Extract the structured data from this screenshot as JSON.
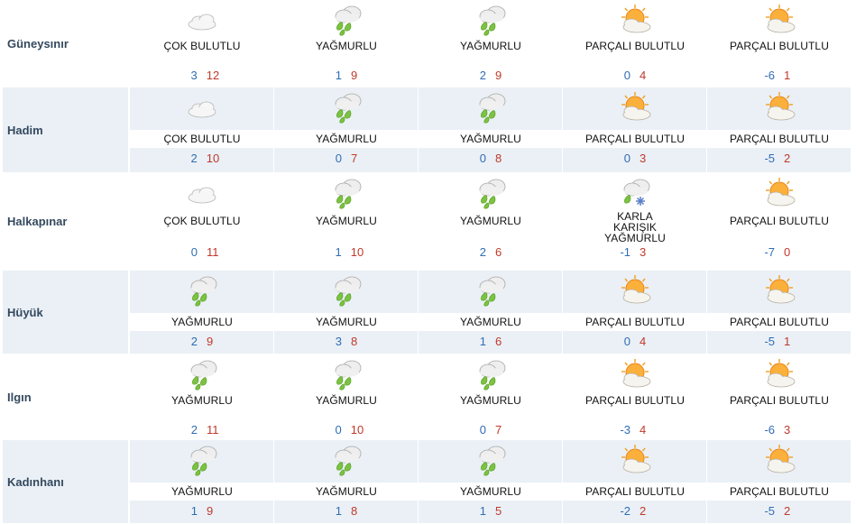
{
  "colors": {
    "city_text": "#34495e",
    "min_temp": "#2f6db5",
    "max_temp": "#c0392b",
    "row_shade": "#eaf0f6"
  },
  "rows": [
    {
      "city": "Güneysınır",
      "days": [
        {
          "icon": "cloudy-icon",
          "condition": "ÇOK BULUTLU",
          "min": "3",
          "max": "12"
        },
        {
          "icon": "rain-icon",
          "condition": "YAĞMURLU",
          "min": "1",
          "max": "9"
        },
        {
          "icon": "rain-icon",
          "condition": "YAĞMURLU",
          "min": "2",
          "max": "9"
        },
        {
          "icon": "partly-cloudy-icon",
          "condition": "PARÇALI BULUTLU",
          "min": "0",
          "max": "4"
        },
        {
          "icon": "partly-cloudy-icon",
          "condition": "PARÇALI BULUTLU",
          "min": "-6",
          "max": "1"
        }
      ]
    },
    {
      "city": "Hadim",
      "days": [
        {
          "icon": "cloudy-icon",
          "condition": "ÇOK BULUTLU",
          "min": "2",
          "max": "10"
        },
        {
          "icon": "rain-icon",
          "condition": "YAĞMURLU",
          "min": "0",
          "max": "7"
        },
        {
          "icon": "rain-icon",
          "condition": "YAĞMURLU",
          "min": "0",
          "max": "8"
        },
        {
          "icon": "partly-cloudy-icon",
          "condition": "PARÇALI BULUTLU",
          "min": "0",
          "max": "3"
        },
        {
          "icon": "partly-cloudy-icon",
          "condition": "PARÇALI BULUTLU",
          "min": "-5",
          "max": "2"
        }
      ]
    },
    {
      "city": "Halkapınar",
      "days": [
        {
          "icon": "cloudy-icon",
          "condition": "ÇOK BULUTLU",
          "min": "0",
          "max": "11"
        },
        {
          "icon": "rain-icon",
          "condition": "YAĞMURLU",
          "min": "1",
          "max": "10"
        },
        {
          "icon": "rain-icon",
          "condition": "YAĞMURLU",
          "min": "2",
          "max": "6"
        },
        {
          "icon": "sleet-icon",
          "condition": "KARLA KARIŞIK YAĞMURLU",
          "min": "-1",
          "max": "3"
        },
        {
          "icon": "partly-cloudy-icon",
          "condition": "PARÇALI BULUTLU",
          "min": "-7",
          "max": "0"
        }
      ]
    },
    {
      "city": "Hüyük",
      "days": [
        {
          "icon": "rain-icon",
          "condition": "YAĞMURLU",
          "min": "2",
          "max": "9"
        },
        {
          "icon": "rain-icon",
          "condition": "YAĞMURLU",
          "min": "3",
          "max": "8"
        },
        {
          "icon": "rain-icon",
          "condition": "YAĞMURLU",
          "min": "1",
          "max": "6"
        },
        {
          "icon": "partly-cloudy-icon",
          "condition": "PARÇALI BULUTLU",
          "min": "0",
          "max": "4"
        },
        {
          "icon": "partly-cloudy-icon",
          "condition": "PARÇALI BULUTLU",
          "min": "-5",
          "max": "1"
        }
      ]
    },
    {
      "city": "Ilgın",
      "days": [
        {
          "icon": "rain-icon",
          "condition": "YAĞMURLU",
          "min": "2",
          "max": "11"
        },
        {
          "icon": "rain-icon",
          "condition": "YAĞMURLU",
          "min": "0",
          "max": "10"
        },
        {
          "icon": "rain-icon",
          "condition": "YAĞMURLU",
          "min": "0",
          "max": "7"
        },
        {
          "icon": "partly-cloudy-icon",
          "condition": "PARÇALI BULUTLU",
          "min": "-3",
          "max": "4"
        },
        {
          "icon": "partly-cloudy-icon",
          "condition": "PARÇALI BULUTLU",
          "min": "-6",
          "max": "3"
        }
      ]
    },
    {
      "city": "Kadınhanı",
      "days": [
        {
          "icon": "rain-icon",
          "condition": "YAĞMURLU",
          "min": "1",
          "max": "9"
        },
        {
          "icon": "rain-icon",
          "condition": "YAĞMURLU",
          "min": "1",
          "max": "8"
        },
        {
          "icon": "rain-icon",
          "condition": "YAĞMURLU",
          "min": "1",
          "max": "5"
        },
        {
          "icon": "partly-cloudy-icon",
          "condition": "PARÇALI BULUTLU",
          "min": "-2",
          "max": "2"
        },
        {
          "icon": "partly-cloudy-icon",
          "condition": "PARÇALI BULUTLU",
          "min": "-5",
          "max": "2"
        }
      ]
    }
  ]
}
